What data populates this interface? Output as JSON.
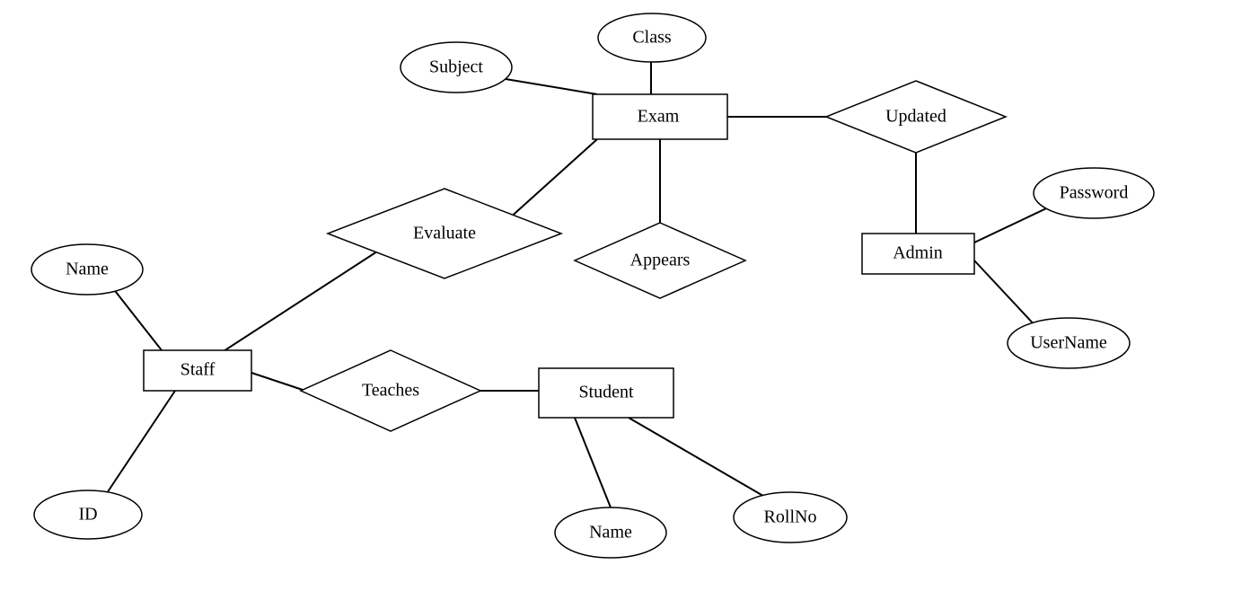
{
  "entities": {
    "exam": "Exam",
    "student": "Student",
    "staff": "Staff",
    "admin": "Admin"
  },
  "relationships": {
    "evaluate": "Evaluate",
    "appears": "Appears",
    "teaches": "Teaches",
    "updated": "Updated"
  },
  "attributes": {
    "exam_class": "Class",
    "exam_subject": "Subject",
    "student_name": "Name",
    "student_rollno": "RollNo",
    "staff_name": "Name",
    "staff_id": "ID",
    "admin_password": "Password",
    "admin_username": "UserName"
  }
}
